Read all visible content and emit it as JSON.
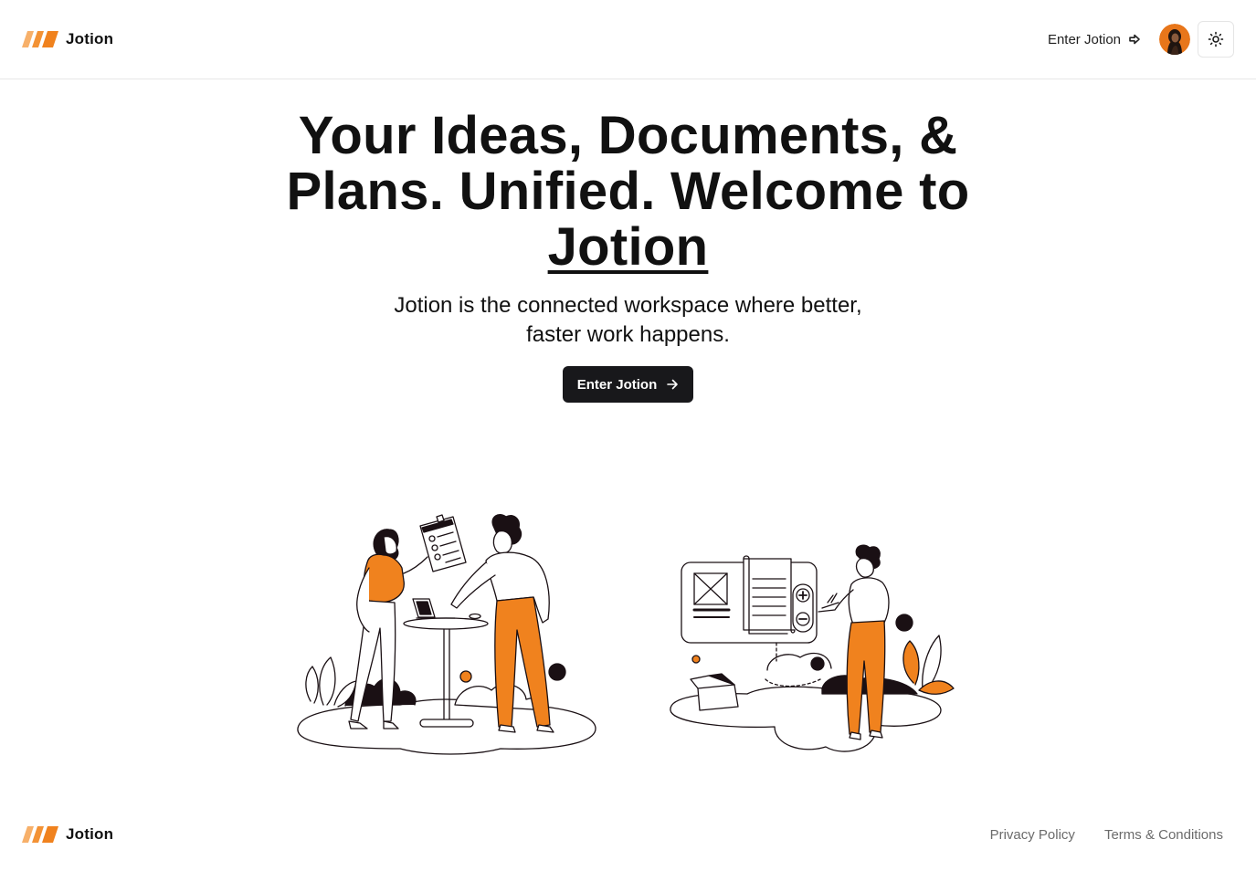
{
  "header": {
    "brand_name": "Jotion",
    "enter_label": "Enter Jotion"
  },
  "hero": {
    "title_line": "Your Ideas, Documents, & Plans. Unified. Welcome to",
    "title_brand": "Jotion",
    "subtitle": "Jotion is the connected workspace where better, faster work happens.",
    "cta_label": "Enter Jotion"
  },
  "footer": {
    "brand_name": "Jotion",
    "links": [
      "Privacy Policy",
      "Terms & Conditions"
    ]
  },
  "colors": {
    "accent": "#f0821e",
    "dark": "#18181b",
    "muted_text": "#6b6b6b"
  },
  "icons": {
    "logo": "logo-icon",
    "enter": "enter-arrow-icon",
    "theme": "sun-icon",
    "cta_arrow": "arrow-right-icon"
  }
}
